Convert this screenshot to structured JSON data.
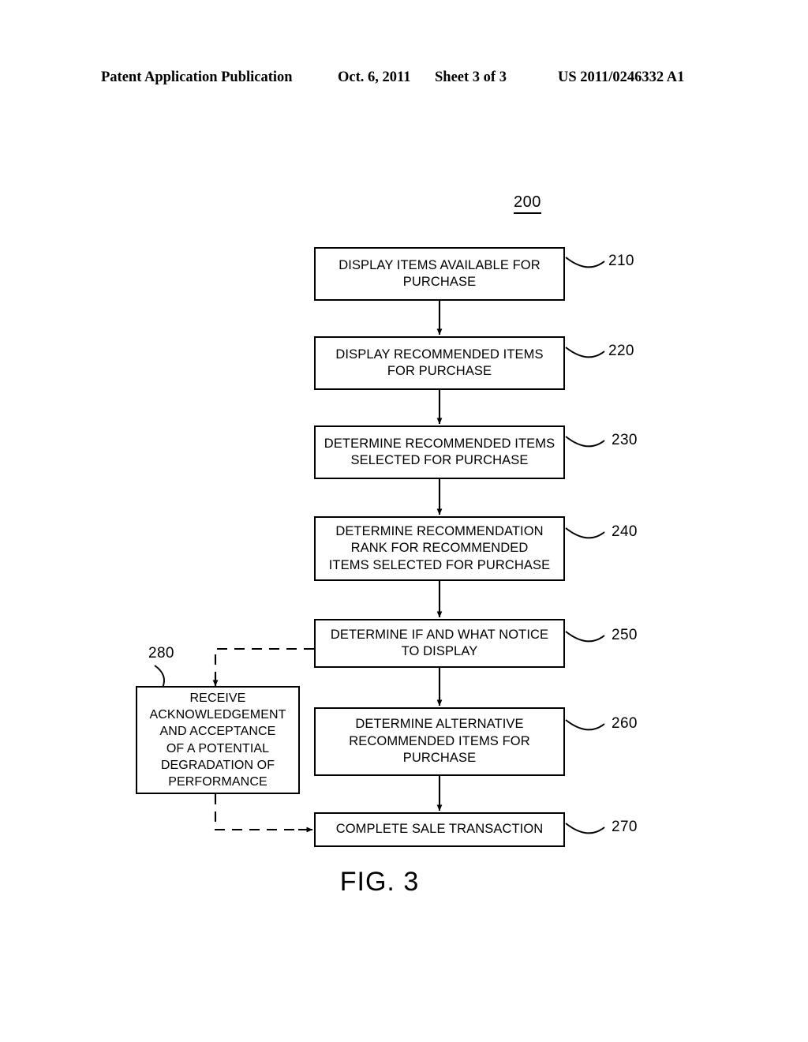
{
  "header": {
    "publication": "Patent Application Publication",
    "date": "Oct. 6, 2011",
    "sheet": "Sheet 3 of 3",
    "document_number": "US 2011/0246332 A1"
  },
  "figure": {
    "id": "200",
    "caption": "FIG. 3"
  },
  "flowchart": {
    "boxes": [
      {
        "ref": "210",
        "text": "DISPLAY ITEMS AVAILABLE FOR\nPURCHASE"
      },
      {
        "ref": "220",
        "text": "DISPLAY RECOMMENDED ITEMS\nFOR PURCHASE"
      },
      {
        "ref": "230",
        "text": "DETERMINE RECOMMENDED ITEMS\nSELECTED FOR PURCHASE"
      },
      {
        "ref": "240",
        "text": "DETERMINE RECOMMENDATION\nRANK FOR RECOMMENDED\nITEMS SELECTED FOR PURCHASE"
      },
      {
        "ref": "250",
        "text": "DETERMINE IF AND WHAT NOTICE\nTO DISPLAY"
      },
      {
        "ref": "260",
        "text": "DETERMINE ALTERNATIVE\nRECOMMENDED ITEMS FOR\nPURCHASE"
      },
      {
        "ref": "270",
        "text": "COMPLETE SALE TRANSACTION"
      },
      {
        "ref": "280",
        "text": "RECEIVE\nACKNOWLEDGEMENT\nAND ACCEPTANCE\nOF A POTENTIAL\nDEGRADATION OF\nPERFORMANCE"
      }
    ]
  }
}
